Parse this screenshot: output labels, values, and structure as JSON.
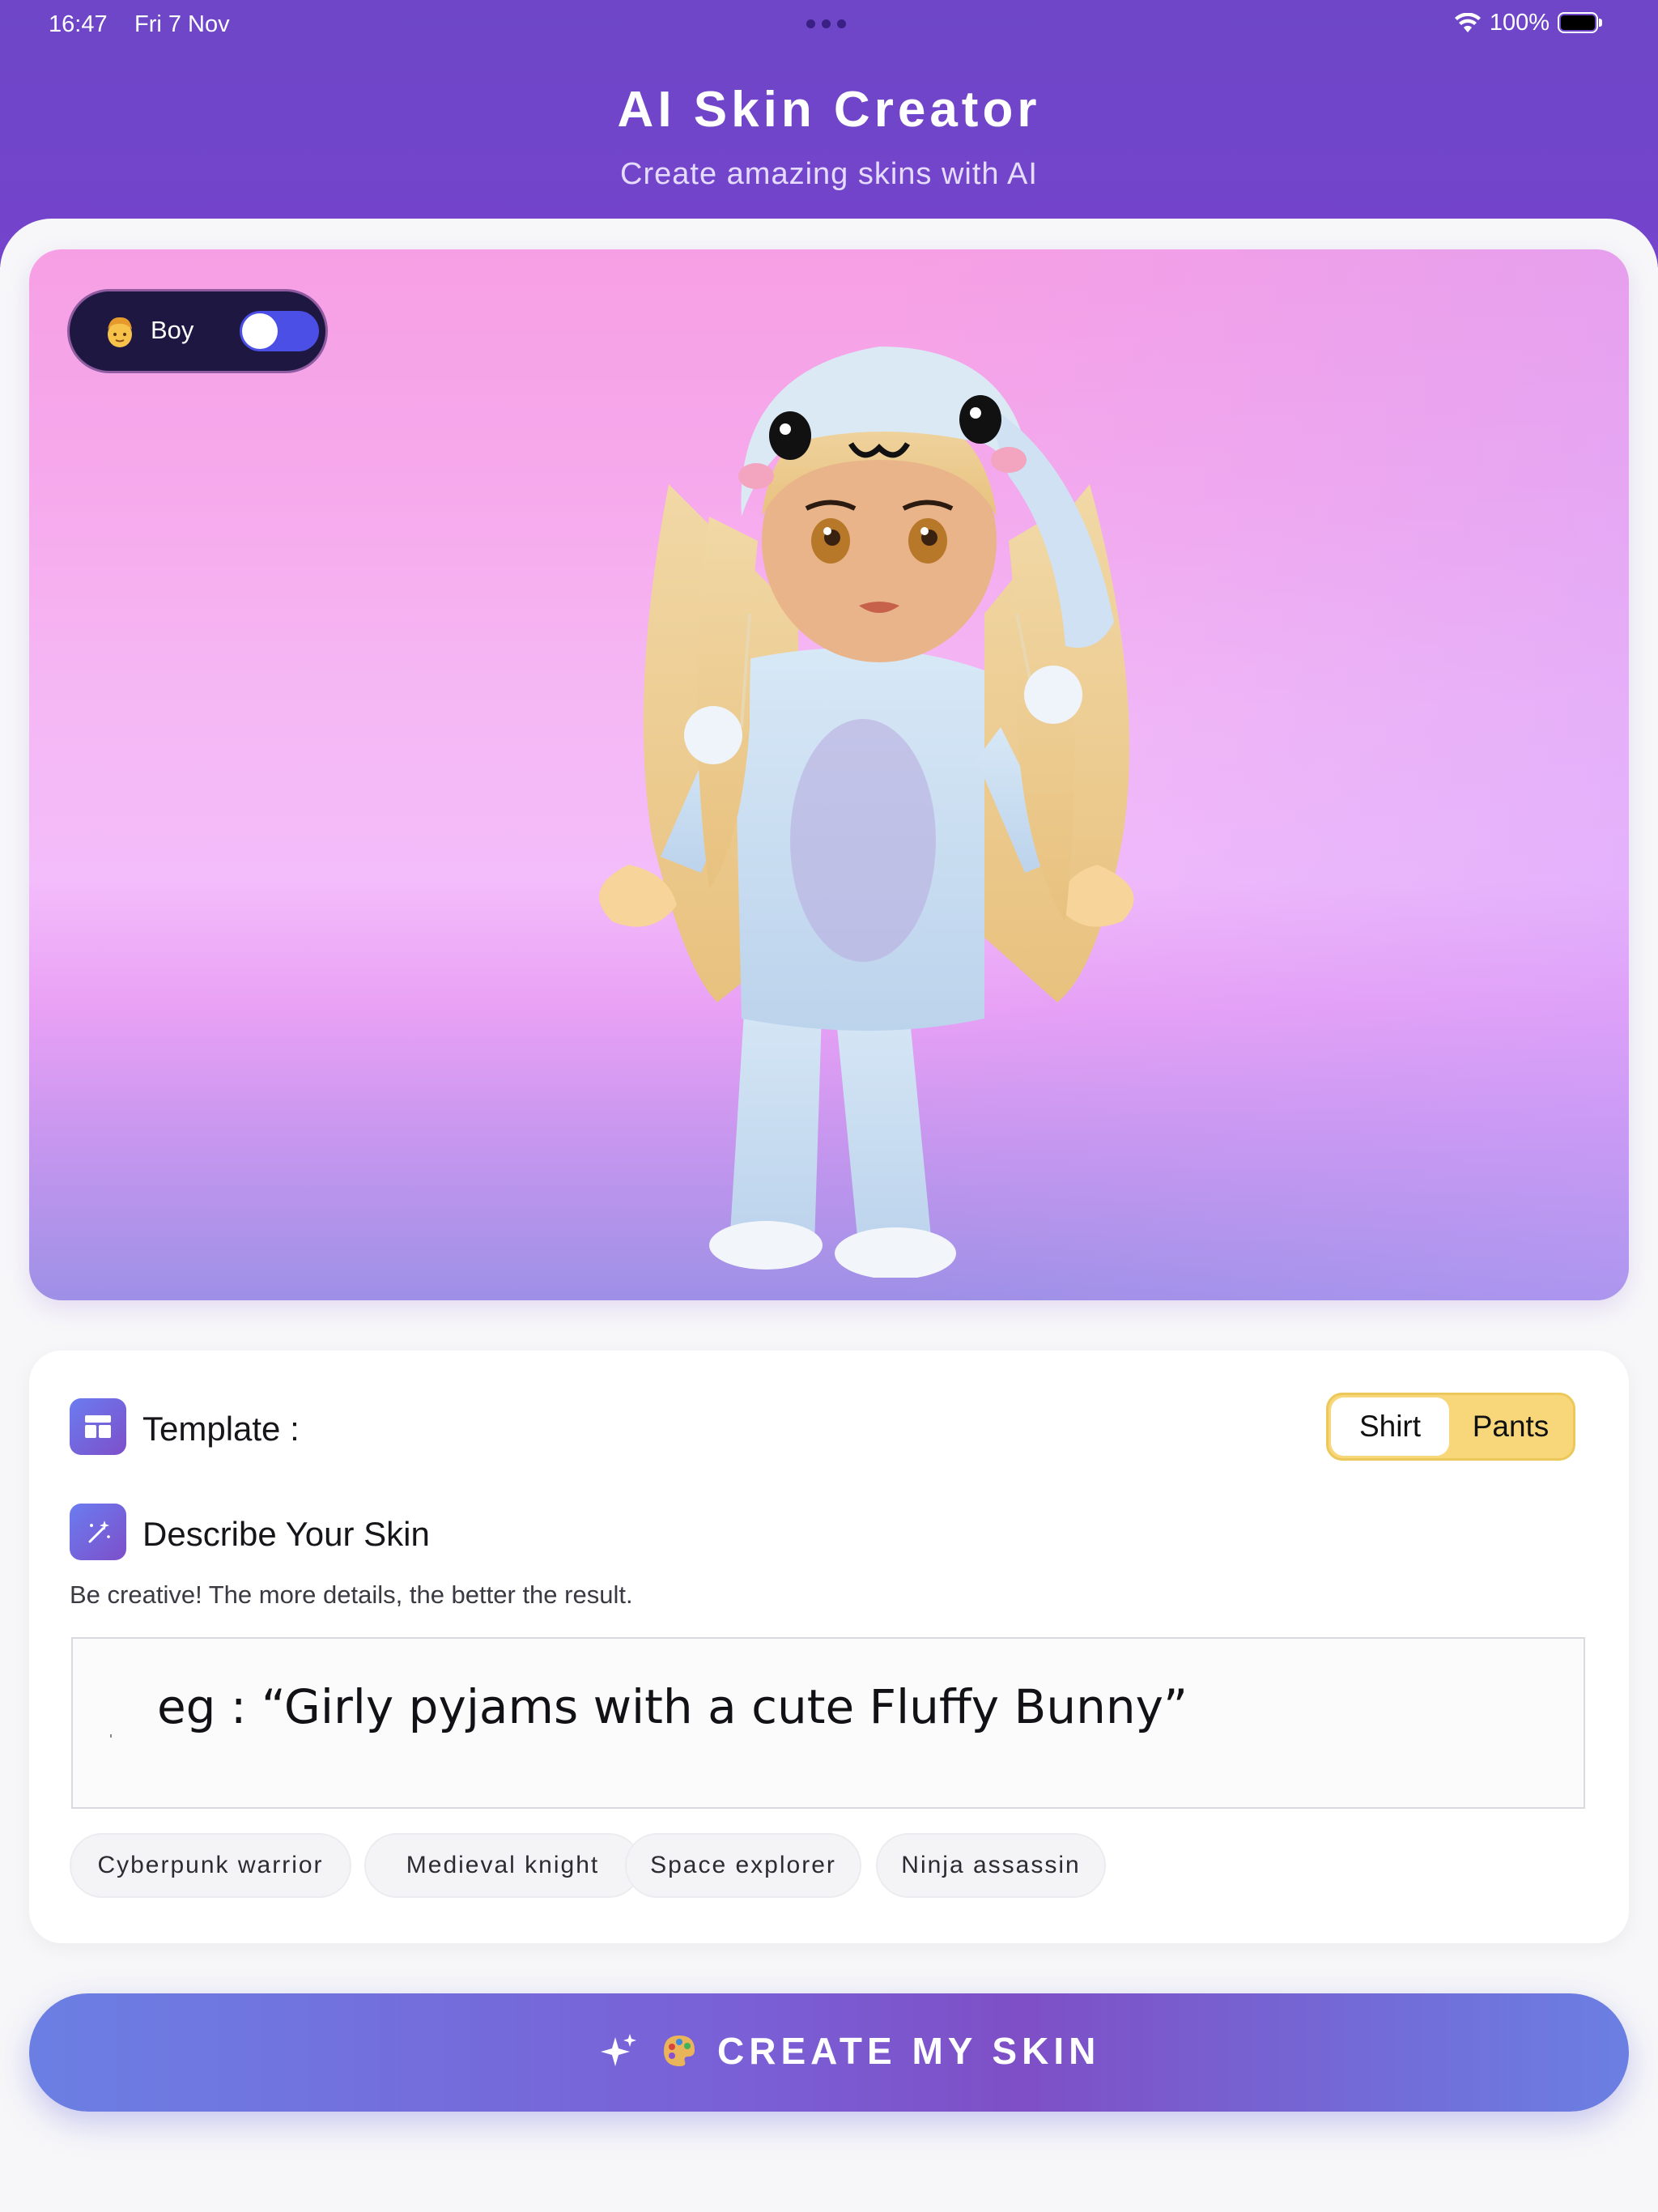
{
  "status_bar": {
    "time": "16:47",
    "date": "Fri 7 Nov",
    "battery": "100%"
  },
  "header": {
    "title": "AI Skin Creator",
    "subtitle": "Create amazing skins with AI"
  },
  "preview": {
    "gender_label": "Boy",
    "gender_toggle_on": false
  },
  "form": {
    "template_label": "Template :",
    "template_options": [
      "Shirt",
      "Pants"
    ],
    "template_selected": "Shirt",
    "describe_label": "Describe Your Skin",
    "helper_text": "Be creative! The more details, the better the result.",
    "prompt_placeholder": "eg : “Girly pyjams with a cute Fluffy Bunny”",
    "suggestions": [
      "Cyberpunk warrior",
      "Medieval knight",
      "Space explorer",
      "Ninja assassin"
    ]
  },
  "cta": {
    "label": "CREATE MY SKIN"
  },
  "colors": {
    "header_purple": "#6e46c7",
    "toggle_blue": "#4b4fe6",
    "segment_yellow": "#f8d77a",
    "cta_start": "#6b7fe3",
    "cta_mid": "#7e4fc6"
  },
  "icons": {
    "template": "layout-icon",
    "describe": "magic-wand-icon",
    "cta_left": "sparkles-icon",
    "cta_right": "palette-icon",
    "gender": "boy-face-icon"
  }
}
